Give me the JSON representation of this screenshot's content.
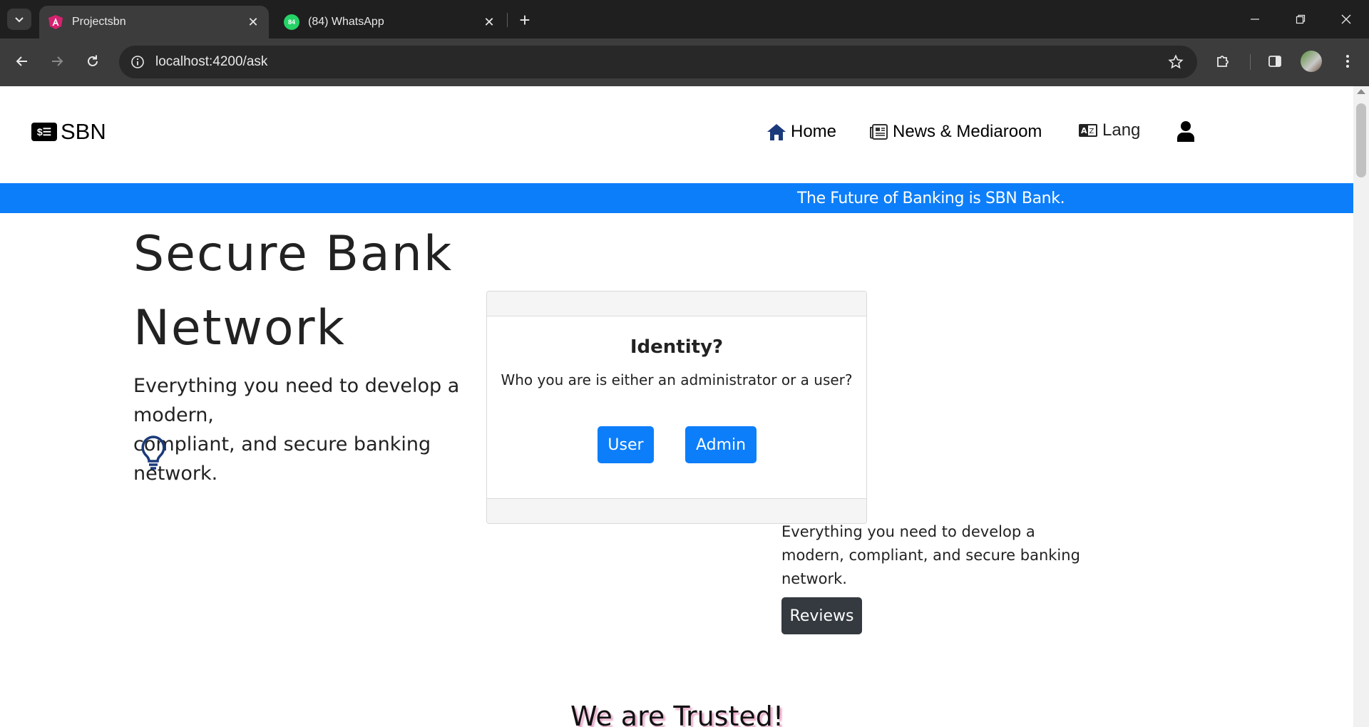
{
  "browser": {
    "tabs": [
      {
        "title": "Projectsbn",
        "active": true,
        "icon": "angular-icon"
      },
      {
        "title": "(84) WhatsApp",
        "active": false,
        "icon": "whatsapp-icon",
        "badge": "84"
      }
    ],
    "url": "localhost:4200/ask"
  },
  "site": {
    "brand": "SBN",
    "nav": {
      "home": "Home",
      "news": "News & Mediaroom",
      "lang": "Lang"
    },
    "banner": "The Future of Banking is SBN Bank.",
    "hero_title_line1": "Secure Bank",
    "hero_title_line2": "Network",
    "hero_subtitle_line1": "Everything you need to develop a modern,",
    "hero_subtitle_line2": "compliant, and secure banking network.",
    "side_text": "Everything you need to develop a modern, compliant, and secure banking network.",
    "reviews_label": "Reviews",
    "trusted_heading": "We are Trusted!"
  },
  "modal": {
    "title": "Identity?",
    "text": "Who you are is either an administrator or a user?",
    "user_label": "User",
    "admin_label": "Admin"
  },
  "colors": {
    "primary": "#0d7ef9",
    "dark_button": "#343a40",
    "nav_icon": "#1b3a7a"
  }
}
